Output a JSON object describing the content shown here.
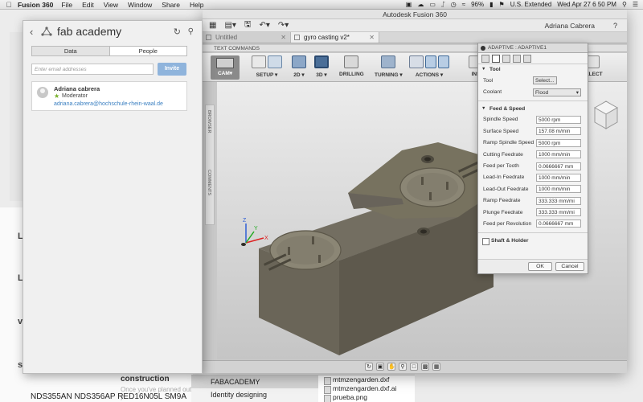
{
  "menubar": {
    "app_name": "Fusion 360",
    "menus": [
      "File",
      "Edit",
      "View",
      "Window",
      "Share",
      "Help"
    ],
    "battery": "96%",
    "input_source": "U.S. Extended",
    "clock": "Wed Apr 27  6 50 PM"
  },
  "background": {
    "headings": [
      "L",
      "L",
      "v",
      "s"
    ],
    "construction": "construction",
    "construction_faint": "Once you've planned out y...",
    "nds": "NDS355AN  NDS356AP  RED16N05L SM9A",
    "folder_items": [
      "FABACADEMY",
      "Identity designing"
    ],
    "files": [
      "mtmzengarden.dxf",
      "mtmzengarden.dxf.ai",
      "prueba.png"
    ]
  },
  "fusion": {
    "window_title": "Autodesk Fusion 360",
    "user": "Adriana Cabrera",
    "help": "?",
    "tabs": [
      {
        "label": "Untitled"
      },
      {
        "label": "gyro casting v2*"
      }
    ],
    "text_commands": "TEXT COMMANDS",
    "workspace": "CAM",
    "toolbar_groups": [
      "SETUP",
      "2D",
      "3D",
      "DRILLING",
      "TURNING",
      "ACTIONS",
      "INS",
      "SELECT"
    ],
    "side_labels": [
      "BROWSER",
      "COMMENTS"
    ]
  },
  "adaptive": {
    "title": "ADAPTIVE : ADAPTIVE1",
    "tool_section": "Tool",
    "tool_label": "Tool",
    "tool_button": "Select...",
    "coolant_label": "Coolant",
    "coolant_value": "Flood",
    "feed_section": "Feed & Speed",
    "fields": [
      {
        "label": "Spindle Speed",
        "value": "5000 rpm"
      },
      {
        "label": "Surface Speed",
        "value": "157.08 m/min"
      },
      {
        "label": "Ramp Spindle Speed",
        "value": "5000 rpm"
      },
      {
        "label": "Cutting Feedrate",
        "value": "1000 mm/min"
      },
      {
        "label": "Feed per Tooth",
        "value": "0.0666667 mm"
      },
      {
        "label": "Lead-In Feedrate",
        "value": "1000 mm/min"
      },
      {
        "label": "Lead-Out Feedrate",
        "value": "1000 mm/min"
      },
      {
        "label": "Ramp Feedrate",
        "value": "333.333 mm/mi"
      },
      {
        "label": "Plunge Feedrate",
        "value": "333.333 mm/mi"
      },
      {
        "label": "Feed per Revolution",
        "value": "0.0666667 mm"
      }
    ],
    "shaft_holder": "Shaft & Holder",
    "ok": "OK",
    "cancel": "Cancel"
  },
  "people": {
    "title": "fab academy",
    "tab_data": "Data",
    "tab_people": "People",
    "invite_placeholder": "Enter email addresses",
    "invite_button": "Invite",
    "member": {
      "name": "Adriana cabrera",
      "role": "Moderator",
      "email": "adriana.cabrera@hochschule-rhein-waal.de"
    }
  }
}
